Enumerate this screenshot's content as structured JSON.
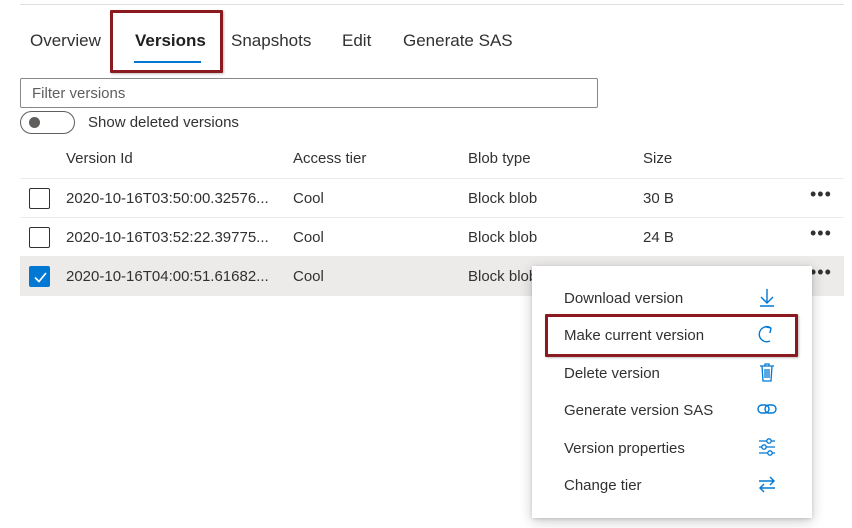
{
  "tabs": [
    {
      "label": "Overview"
    },
    {
      "label": "Versions"
    },
    {
      "label": "Snapshots"
    },
    {
      "label": "Edit"
    },
    {
      "label": "Generate SAS"
    }
  ],
  "active_tab": "Versions",
  "filter": {
    "placeholder": "Filter versions",
    "value": ""
  },
  "toggle": {
    "label": "Show deleted versions",
    "checked": false
  },
  "table": {
    "columns": [
      "Version Id",
      "Access tier",
      "Blob type",
      "Size"
    ],
    "rows": [
      {
        "version_id": "2020-10-16T03:50:00.32576...",
        "access_tier": "Cool",
        "blob_type": "Block blob",
        "size": "30 B",
        "checked": false
      },
      {
        "version_id": "2020-10-16T03:52:22.39775...",
        "access_tier": "Cool",
        "blob_type": "Block blob",
        "size": "24 B",
        "checked": false
      },
      {
        "version_id": "2020-10-16T04:00:51.61682...",
        "access_tier": "Cool",
        "blob_type": "Block blob",
        "size": "",
        "checked": true
      }
    ],
    "more_label": "•••"
  },
  "context_menu": {
    "items": [
      {
        "label": "Download version",
        "icon": "download-icon"
      },
      {
        "label": "Make current version",
        "icon": "restore-icon"
      },
      {
        "label": "Delete version",
        "icon": "trash-icon"
      },
      {
        "label": "Generate version SAS",
        "icon": "link-icon"
      },
      {
        "label": "Version properties",
        "icon": "sliders-icon"
      },
      {
        "label": "Change tier",
        "icon": "swap-arrows-icon"
      }
    ],
    "highlighted_item": "Make current version"
  },
  "colors": {
    "accent": "#0078d4",
    "highlight_box": "#8a1a1f",
    "selected_row": "#edebe9"
  }
}
